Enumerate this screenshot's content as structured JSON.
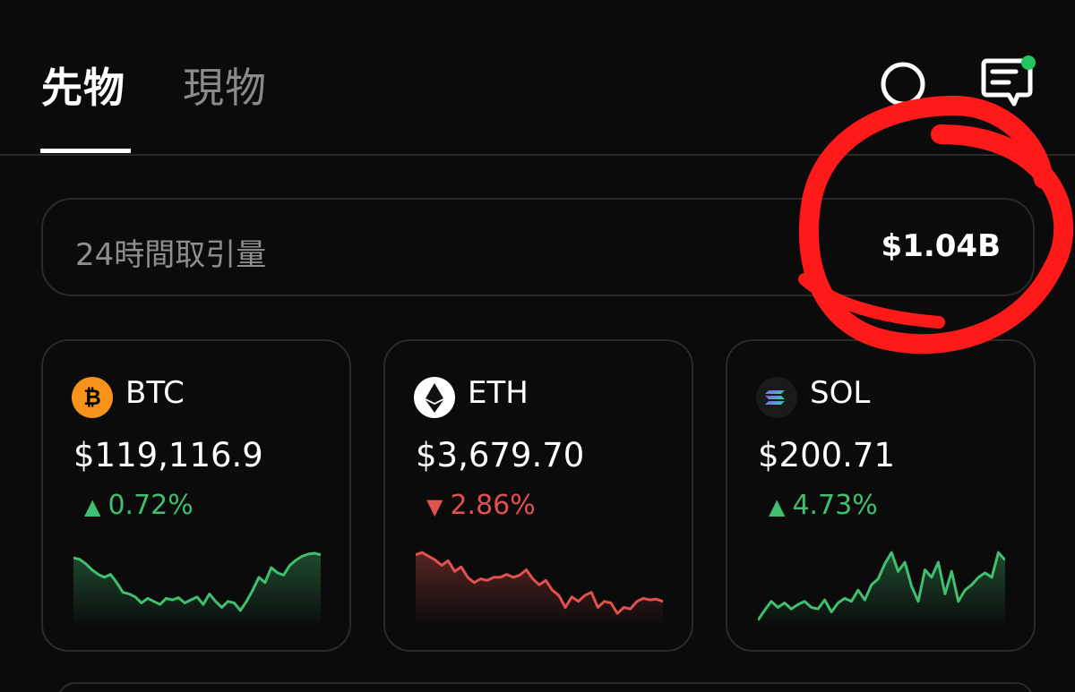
{
  "tabs": [
    {
      "label": "先物",
      "active": true
    },
    {
      "label": "現物",
      "active": false
    }
  ],
  "header": {
    "search_icon": "search-icon",
    "message_icon": "message-icon",
    "notification_dot_color": "#22c55e"
  },
  "volume": {
    "label": "24時間取引量",
    "value": "$1.04B"
  },
  "colors": {
    "up": "#3fbf6f",
    "down": "#e2514e",
    "annotation": "#ff1a1a"
  },
  "coins": [
    {
      "symbol": "BTC",
      "icon": "bitcoin-icon",
      "price": "$119,116.9",
      "change": "0.72%",
      "direction": "up",
      "spark": [
        0.88,
        0.86,
        0.8,
        0.72,
        0.66,
        0.62,
        0.66,
        0.55,
        0.42,
        0.4,
        0.36,
        0.28,
        0.34,
        0.3,
        0.26,
        0.34,
        0.32,
        0.35,
        0.28,
        0.32,
        0.36,
        0.26,
        0.4,
        0.3,
        0.22,
        0.3,
        0.28,
        0.18,
        0.3,
        0.45,
        0.62,
        0.55,
        0.75,
        0.68,
        0.65,
        0.78,
        0.85,
        0.9,
        0.93,
        0.94,
        0.92
      ]
    },
    {
      "symbol": "ETH",
      "icon": "ethereum-icon",
      "price": "$3,679.70",
      "change": "2.86%",
      "direction": "down",
      "spark": [
        0.92,
        0.95,
        0.9,
        0.85,
        0.78,
        0.84,
        0.7,
        0.76,
        0.62,
        0.55,
        0.6,
        0.58,
        0.62,
        0.62,
        0.66,
        0.62,
        0.65,
        0.72,
        0.6,
        0.52,
        0.58,
        0.45,
        0.38,
        0.22,
        0.36,
        0.3,
        0.38,
        0.42,
        0.22,
        0.3,
        0.28,
        0.14,
        0.22,
        0.2,
        0.3,
        0.34,
        0.32,
        0.33,
        0.3
      ]
    },
    {
      "symbol": "SOL",
      "icon": "solana-icon",
      "price": "$200.71",
      "change": "4.73%",
      "direction": "up",
      "spark": [
        0.05,
        0.18,
        0.3,
        0.22,
        0.28,
        0.2,
        0.26,
        0.3,
        0.22,
        0.2,
        0.32,
        0.16,
        0.28,
        0.34,
        0.3,
        0.45,
        0.32,
        0.52,
        0.6,
        0.8,
        0.95,
        0.7,
        0.82,
        0.5,
        0.3,
        0.72,
        0.62,
        0.82,
        0.4,
        0.7,
        0.3,
        0.45,
        0.52,
        0.62,
        0.68,
        0.62,
        0.95,
        0.85
      ]
    }
  ]
}
